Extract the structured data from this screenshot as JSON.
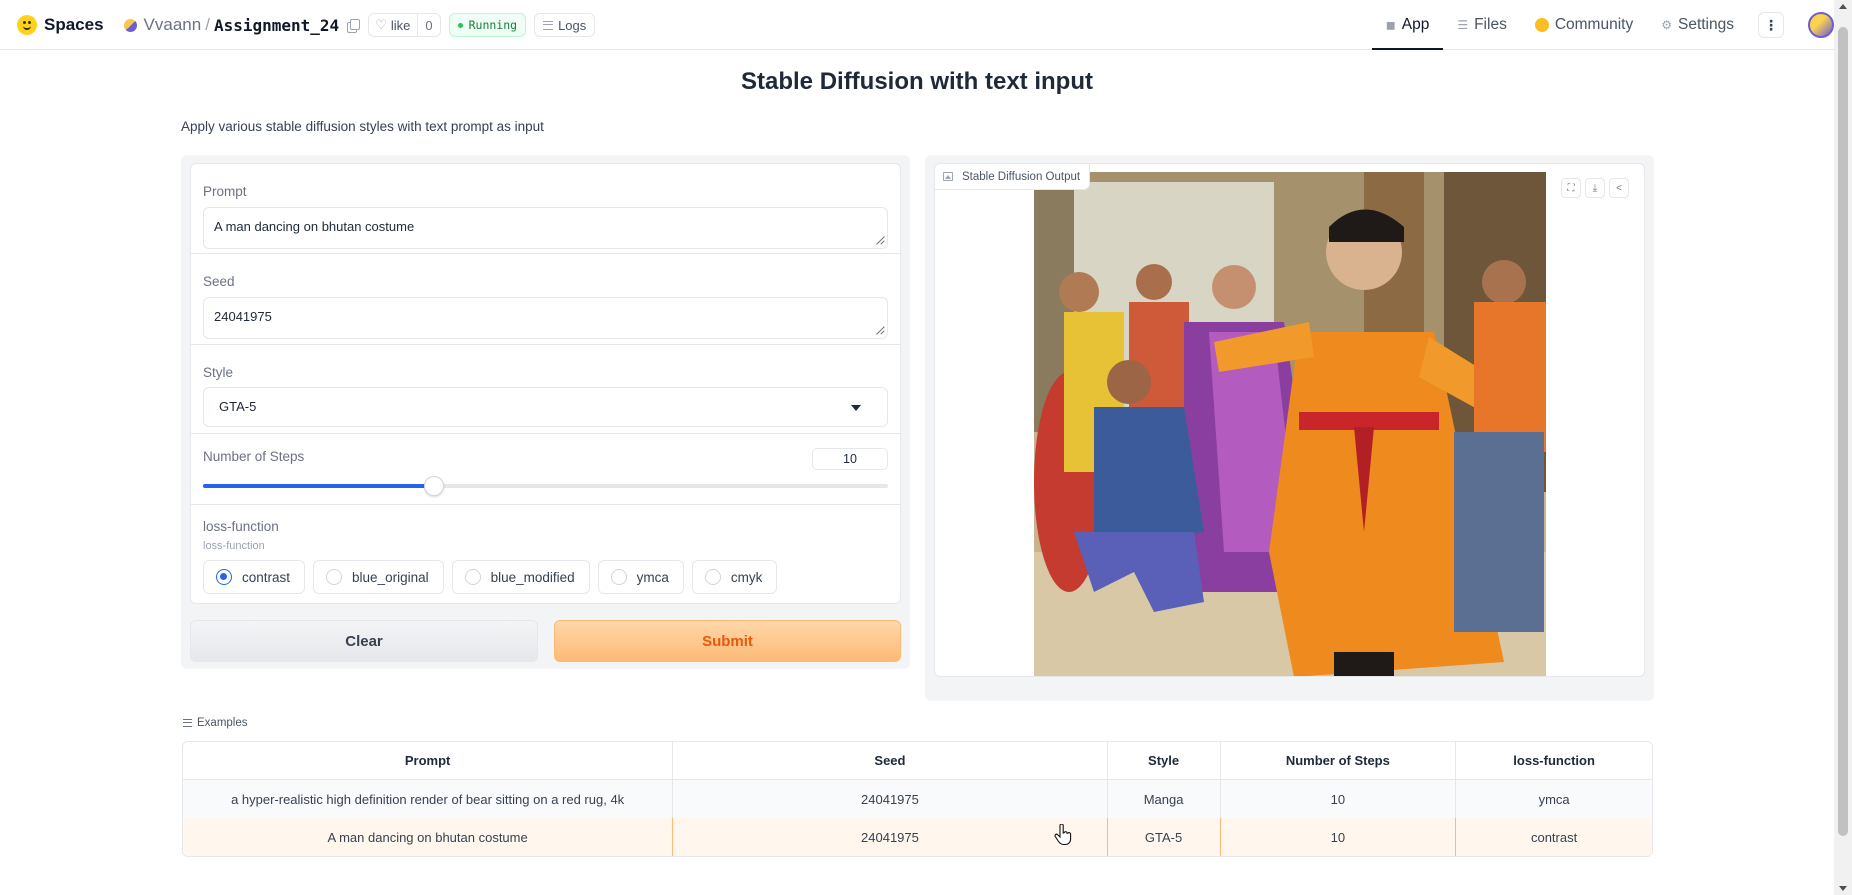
{
  "nav": {
    "spaces_label": "Spaces",
    "owner": "Vvaann",
    "separator": "/",
    "repo": "Assignment_24",
    "like_label": "like",
    "like_count": "0",
    "status": "Running",
    "logs_label": "Logs",
    "tabs": [
      {
        "label": "App",
        "icon": "cube-icon",
        "active": true
      },
      {
        "label": "Files",
        "icon": "files-icon",
        "active": false
      },
      {
        "label": "Community",
        "icon": "coin-icon",
        "active": false
      },
      {
        "label": "Settings",
        "icon": "gear-icon",
        "active": false
      }
    ],
    "more_label": "⋮"
  },
  "app": {
    "title": "Stable Diffusion with text input",
    "description": "Apply various stable diffusion styles with text prompt as input"
  },
  "form": {
    "prompt": {
      "label": "Prompt",
      "value": "A man dancing on bhutan costume"
    },
    "seed": {
      "label": "Seed",
      "value": "24041975"
    },
    "style": {
      "label": "Style",
      "value": "GTA-5"
    },
    "steps": {
      "label": "Number of Steps",
      "value": "10",
      "slider_fraction": 0.337
    },
    "loss": {
      "label": "loss-function",
      "sublabel": "loss-function",
      "options": [
        "contrast",
        "blue_original",
        "blue_modified",
        "ymca",
        "cmyk"
      ],
      "selected": "contrast"
    },
    "clear_label": "Clear",
    "submit_label": "Submit"
  },
  "output": {
    "label": "Stable Diffusion Output",
    "tools": [
      "fullscreen-icon",
      "download-icon",
      "share-icon"
    ]
  },
  "examples": {
    "label": "Examples",
    "headers": [
      "Prompt",
      "Seed",
      "Style",
      "Number of Steps",
      "loss-function"
    ],
    "rows": [
      [
        "a hyper-realistic high definition render of bear sitting on a red rug, 4k",
        "24041975",
        "Manga",
        "10",
        "ymca"
      ],
      [
        "A man dancing on bhutan costume",
        "24041975",
        "GTA-5",
        "10",
        "contrast"
      ]
    ]
  },
  "colors": {
    "accent": "#2563eb",
    "submit": "#fdba74",
    "status_green": "#22c55e"
  }
}
